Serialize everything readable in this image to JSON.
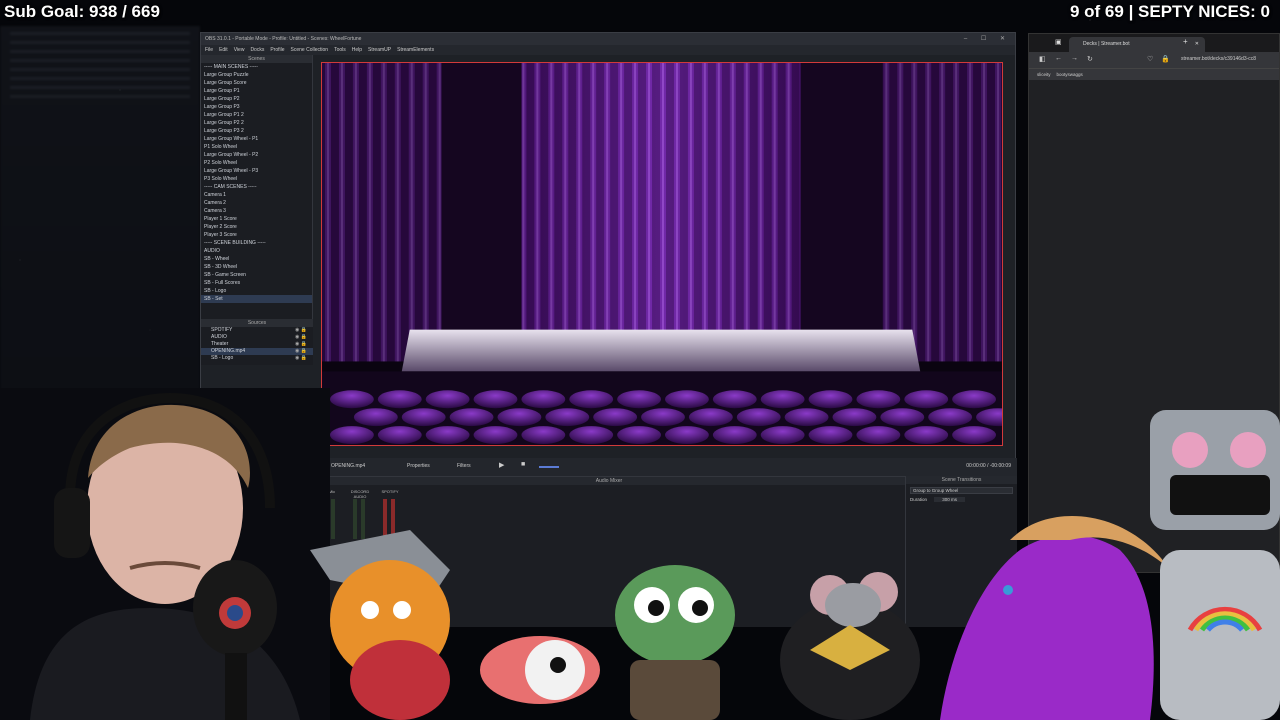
{
  "overlay": {
    "sub_goal": "Sub Goal: 938 / 669",
    "septy": "9 of 69 | SEPTY NICES: 0"
  },
  "obs": {
    "title": "OBS 31.0.1 - Portable Mode - Profile: Untitled - Scenes: WheelFortune",
    "menu": [
      "File",
      "Edit",
      "View",
      "Docks",
      "Profile",
      "Scene Collection",
      "Tools",
      "Help",
      "StreamUP",
      "StreamElements"
    ],
    "scenes_header": "Scenes",
    "scenes": [
      "----- MAIN SCENES -----",
      "Large Group Puzzle",
      "Large Group Score",
      "Large Group P1",
      "Large Group P2",
      "Large Group P3",
      "Large Group P1 2",
      "Large Group P2 2",
      "Large Group P3 2",
      "Large Group Wheel - P1",
      "P1 Solo Wheel",
      "Large Group Wheel - P2",
      "P2 Solo Wheel",
      "Large Group Wheel - P3",
      "P3 Solo Wheel",
      "----- CAM SCENES -----",
      "Camera 1",
      "Camera 2",
      "Camera 3",
      "Player 1 Score",
      "Player 2 Score",
      "Player 3 Score",
      "----- SCENE BUILDING -----",
      "AUDIO",
      "SB - Wheel",
      "SB - 3D Wheel",
      "SB - Game Screen",
      "SB - Full Scores",
      "SB - Logo",
      "SB - Set"
    ],
    "selected_scene_index": 29,
    "sources_header": "Sources",
    "sources": [
      "SPOTIFY",
      "AUDIO",
      "Theater",
      "OPENING.mp4",
      "SB - Logo"
    ],
    "selected_source_index": 3,
    "transport": {
      "source": "OPENING.mp4",
      "properties": "Properties",
      "filters": "Filters",
      "time": "00:00:00 / -00:00:09"
    },
    "mixer_title": "Audio Mixer",
    "channels": [
      "E-Mic",
      "DISCORD AUDIO",
      "SPOTIFY"
    ],
    "transitions_title": "Scene Transitions",
    "transition_selected": "Group to Group Wheel",
    "duration_label": "Duration",
    "duration_value": "300 ms"
  },
  "browser": {
    "tab_title": "Decks | Streamer.bot",
    "url": "streamer.bot/decks/c39146d3-cc8",
    "bookmarks": [
      "sliceity",
      "bootyswaggs"
    ]
  },
  "colors": {
    "accent_red": "#d23a3a",
    "curtain_purple": "#6a1a9a",
    "obs_bg": "#1e2126"
  }
}
